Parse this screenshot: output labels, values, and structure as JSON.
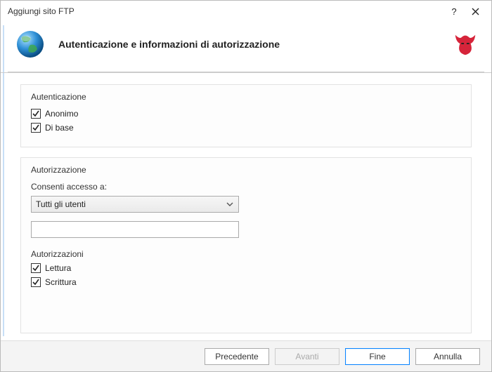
{
  "titlebar": {
    "title": "Aggiungi sito FTP"
  },
  "header": {
    "title": "Autenticazione e informazioni di autorizzazione"
  },
  "auth": {
    "group_title": "Autenticazione",
    "anonymous_label": "Anonimo",
    "basic_label": "Di base"
  },
  "authz": {
    "group_title": "Autorizzazione",
    "allow_label": "Consenti accesso a:",
    "select_value": "Tutti gli utenti",
    "perm_title": "Autorizzazioni",
    "read_label": "Lettura",
    "write_label": "Scrittura"
  },
  "footer": {
    "prev": "Precedente",
    "next": "Avanti",
    "finish": "Fine",
    "cancel": "Annulla"
  }
}
